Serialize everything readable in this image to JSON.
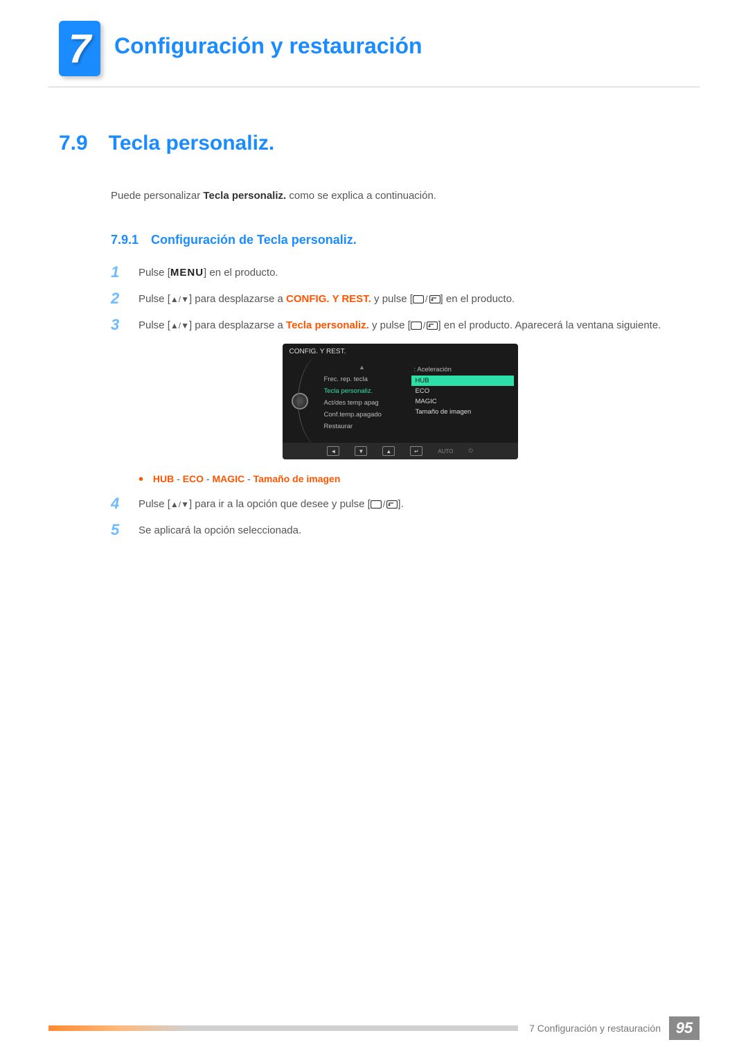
{
  "chapter": {
    "number": "7",
    "title": "Configuración y restauración"
  },
  "section": {
    "number": "7.9",
    "title": "Tecla personaliz."
  },
  "intro": {
    "pre": "Puede personalizar ",
    "bold": "Tecla personaliz.",
    "post": " como se explica a continuación."
  },
  "subsection": {
    "number": "7.9.1",
    "title": "Configuración de Tecla personaliz."
  },
  "steps": {
    "s1": {
      "num": "1",
      "pre": "Pulse [",
      "menu": "MENU",
      "post": "] en el producto."
    },
    "s2": {
      "num": "2",
      "pre": "Pulse [",
      "mid1": "] para desplazarse a ",
      "target": "CONFIG. Y REST.",
      "mid2": " y pulse [",
      "post": "] en el producto."
    },
    "s3": {
      "num": "3",
      "pre": "Pulse [",
      "mid1": "] para desplazarse a ",
      "target": "Tecla personaliz.",
      "mid2": " y pulse [",
      "post": "] en el producto. Aparecerá la ventana siguiente."
    },
    "s4": {
      "num": "4",
      "pre": "Pulse [",
      "mid": "] para ir a la opción que desee y pulse [",
      "post": "]."
    },
    "s5": {
      "num": "5",
      "text": "Se aplicará la opción seleccionada."
    }
  },
  "osd": {
    "title": "CONFIG. Y REST.",
    "up": "▲",
    "left_items": [
      {
        "label": "Frec. rep. tecla",
        "active": false
      },
      {
        "label": "Tecla personaliz.",
        "active": true
      },
      {
        "label": "Act/des temp apag",
        "active": false
      },
      {
        "label": "Conf.temp.apagado",
        "active": false
      },
      {
        "label": "Restaurar",
        "active": false
      }
    ],
    "right_label": ": Aceleración",
    "right_opts": [
      {
        "label": "HUB",
        "highlight": true
      },
      {
        "label": "ECO",
        "highlight": false
      },
      {
        "label": "MAGIC",
        "highlight": false
      },
      {
        "label": "Tamaño de imagen",
        "highlight": false
      }
    ],
    "footer": {
      "b1": "◄",
      "b2": "▼",
      "b3": "▲",
      "b4": "↵",
      "auto": "AUTO",
      "pwr": "⏻"
    }
  },
  "bullet": {
    "o1": "HUB",
    "sep": " - ",
    "o2": "ECO",
    "o3": "MAGIC",
    "o4": "Tamaño de imagen"
  },
  "footer": {
    "text": "7 Configuración y restauración",
    "page": "95"
  }
}
